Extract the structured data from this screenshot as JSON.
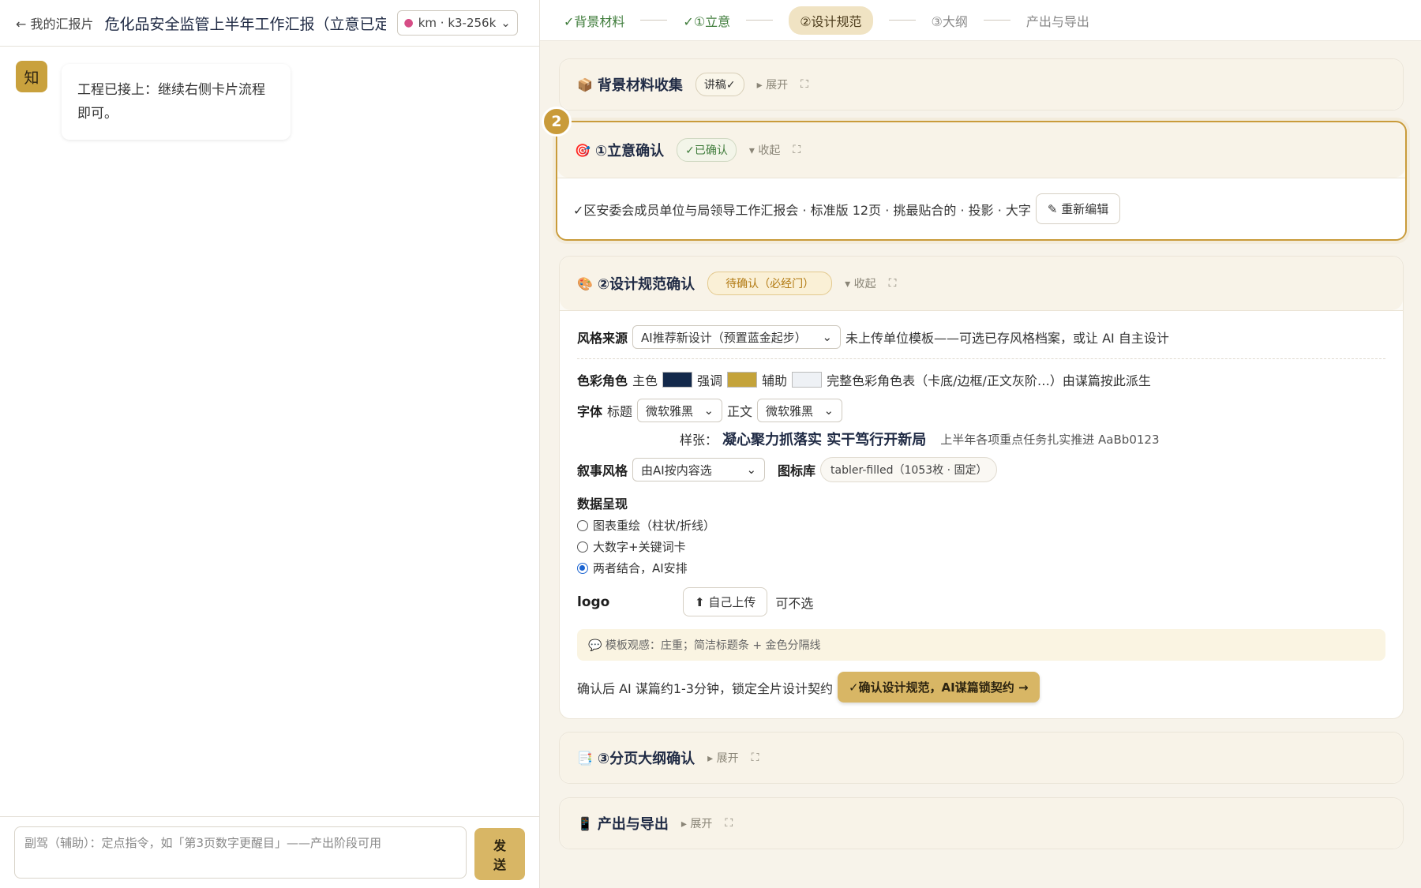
{
  "left": {
    "back_label": "← 我的汇报片",
    "doc_title": "危化品安全监管上半年工作汇报（立意已定",
    "model": {
      "icon": "brain-icon",
      "label": "km · k3-256k"
    },
    "avatar": "知",
    "message": "工程已接上：继续右侧卡片流程即可。",
    "composer_placeholder": "副驾（辅助）：定点指令，如「第3页数字更醒目」——产出阶段可用",
    "send_label": "发送"
  },
  "steps": [
    {
      "label": "✓背景材料",
      "state": "done"
    },
    {
      "label": "✓①立意",
      "state": "done"
    },
    {
      "label": "②设计规范",
      "state": "active"
    },
    {
      "label": "③大纲",
      "state": "todo"
    },
    {
      "label": "产出与导出",
      "state": "todo"
    }
  ],
  "cards": {
    "background": {
      "icon": "📦",
      "title": "背景材料收集",
      "pill": "讲稿✓",
      "toggle": "▸ 展开",
      "expand": "⛶"
    },
    "intent": {
      "badge": "2",
      "icon": "🎯",
      "title": "①立意确认",
      "pill": "✓已确认",
      "toggle": "▾ 收起",
      "expand": "⛶",
      "summary": "✓区安委会成员单位与局领导工作汇报会 · 标准版 12页 · 挑最贴合的 · 投影 · 大字",
      "edit_label": "✎ 重新编辑"
    },
    "design": {
      "icon": "🎨",
      "title": "②设计规范确认",
      "pill": "待确认（必经门）",
      "toggle": "▾ 收起",
      "expand": "⛶",
      "style_label": "风格来源",
      "style_value": "AI推荐新设计（预置蓝金起步）",
      "style_note": "未上传单位模板——可选已存风格档案，或让 AI 自主设计",
      "color_label": "色彩角色",
      "primary_label": "主色",
      "primary_color": "#13294b",
      "accent_label": "强调",
      "accent_color": "#c4a33a",
      "aux_label": "辅助",
      "aux_color": "#eef1f5",
      "color_note": "完整色彩角色表（卡底/边框/正文灰阶…）由谋篇按此派生",
      "font_label": "字体",
      "title_font_label": "标题",
      "title_font_value": "微软雅黑",
      "body_font_label": "正文",
      "body_font_value": "微软雅黑",
      "sample_label": "样张：",
      "sample_title": "凝心聚力抓落实 实干笃行开新局",
      "sample_body": "上半年各项重点任务扎实推进 AaBb0123",
      "narrative_label": "叙事风格",
      "narrative_value": "由AI按内容选",
      "icons_label": "图标库",
      "icons_value": "tabler-filled（1053枚 · 固定）",
      "data_label": "数据呈现",
      "data_options": [
        {
          "label": "图表重绘（柱状/折线）",
          "checked": false
        },
        {
          "label": "大数字+关键词卡",
          "checked": false
        },
        {
          "label": "两者结合，AI安排",
          "checked": true
        }
      ],
      "logo_label": "logo",
      "upload_label": "⬆ 自己上传",
      "logo_note": "可不选",
      "template_note": "💬 模板观感：庄重；简洁标题条 + 金色分隔线",
      "confirm_text": "确认后 AI 谋篇约1-3分钟，锁定全片设计契约",
      "confirm_label": "✓确认设计规范，AI谋篇锁契约 →"
    },
    "outline": {
      "icon": "📑",
      "title": "③分页大纲确认",
      "toggle": "▸ 展开",
      "expand": "⛶"
    },
    "export": {
      "icon": "📱",
      "title": "产出与导出",
      "toggle": "▸ 展开",
      "expand": "⛶"
    }
  }
}
